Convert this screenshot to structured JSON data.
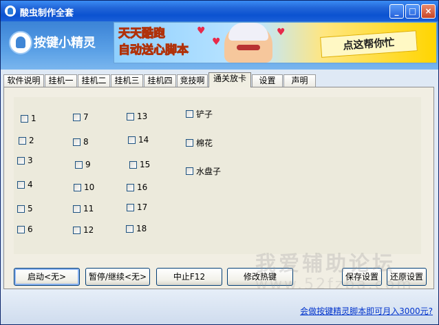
{
  "window": {
    "title": "酸虫制作全套",
    "minimize_symbol": "_",
    "maximize_symbol": "□",
    "close_symbol": "×"
  },
  "header": {
    "logo_text": "按键小精灵",
    "banner_slogan_line1": "天天酷跑",
    "banner_slogan_line2": "自动送心脚本",
    "banner_cta": "点这帮你忙"
  },
  "tabs": [
    "软件说明",
    "挂机一",
    "挂机二",
    "挂机三",
    "挂机四",
    "竞技啊",
    "通关放卡",
    "设置",
    "声明"
  ],
  "active_tab": "通关放卡",
  "checkboxes": {
    "col1": [
      "1",
      "2",
      "3",
      "4",
      "5",
      "6"
    ],
    "col2": [
      "7",
      "8",
      "9",
      "10",
      "11",
      "12"
    ],
    "col3": [
      "13",
      "14",
      "15",
      "16",
      "17",
      "18"
    ],
    "col4": [
      "铲子",
      "棉花",
      "水盘子"
    ]
  },
  "buttons": {
    "start": "启动<无>",
    "pause": "暂停/继续<无>",
    "stop": "中止F12",
    "hotkey": "修改热键",
    "save": "保存设置",
    "restore": "还原设置"
  },
  "watermark": {
    "line1": "我爱辅助论坛",
    "line2": "www.52fzba.com"
  },
  "footer": {
    "link": "会做按键精灵脚本即可月入3000元?"
  },
  "colors": {
    "title_bar": "#0b52d1",
    "panel_bg": "#f1eee3",
    "link": "#0033cc"
  }
}
